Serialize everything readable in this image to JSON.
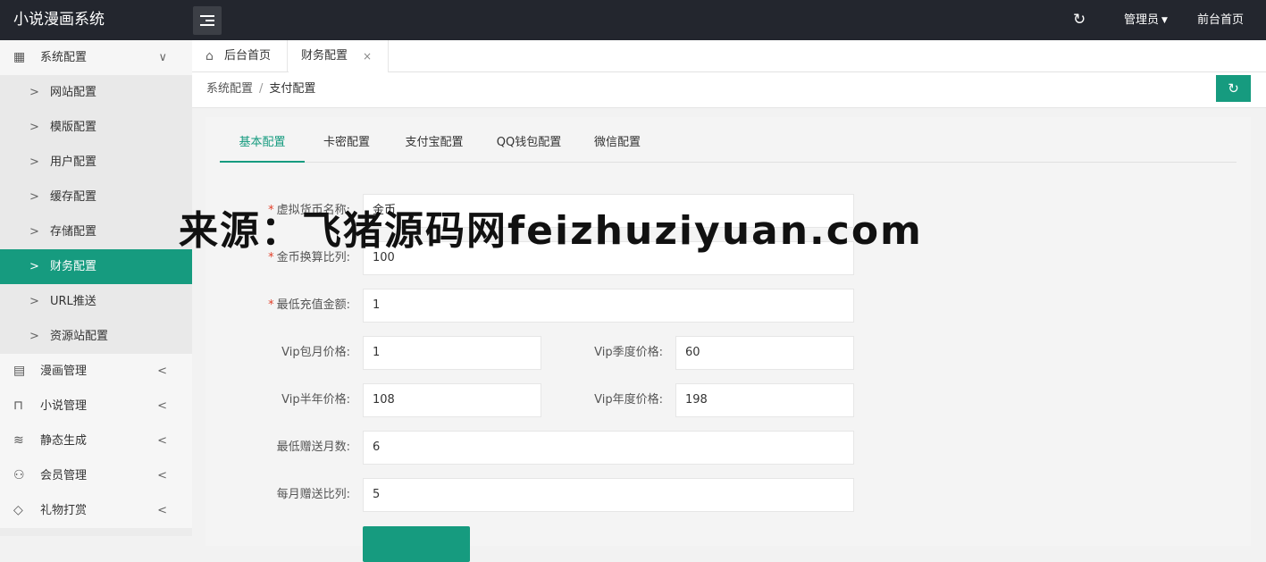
{
  "app": {
    "title": "小说漫画系统",
    "user_menu": "管理员",
    "front_link": "前台首页"
  },
  "icons": {
    "menu_toggle": "hamburger-icon",
    "refresh": "refresh-icon",
    "caret": "caret-down-icon",
    "home": "home-icon",
    "close": "close-icon"
  },
  "sidebar": {
    "groups": [
      {
        "label": "系统配置",
        "icon": "grid-icon",
        "glyph": "▦",
        "expanded": true,
        "chevron": "∨"
      },
      {
        "label": "漫画管理",
        "icon": "book-icon",
        "glyph": "▤",
        "expanded": false,
        "chevron": "<"
      },
      {
        "label": "小说管理",
        "icon": "open-book-icon",
        "glyph": "⊓",
        "expanded": false,
        "chevron": "<"
      },
      {
        "label": "静态生成",
        "icon": "layers-icon",
        "glyph": "≋",
        "expanded": false,
        "chevron": "<"
      },
      {
        "label": "会员管理",
        "icon": "user-icon",
        "glyph": "⚇",
        "expanded": false,
        "chevron": "<"
      },
      {
        "label": "礼物打赏",
        "icon": "diamond-icon",
        "glyph": "◇",
        "expanded": false,
        "chevron": "<"
      }
    ],
    "sub_items": [
      {
        "label": "网站配置"
      },
      {
        "label": "模版配置"
      },
      {
        "label": "用户配置"
      },
      {
        "label": "缓存配置"
      },
      {
        "label": "存储配置"
      },
      {
        "label": "财务配置",
        "active": true
      },
      {
        "label": "URL推送"
      },
      {
        "label": "资源站配置"
      }
    ],
    "sub_arrow": ">"
  },
  "tabs": [
    {
      "label": "后台首页"
    },
    {
      "label": "财务配置",
      "close": "×"
    }
  ],
  "breadcrumb": {
    "parent": "系统配置",
    "separator": "/",
    "current": "支付配置"
  },
  "subtabs": [
    {
      "label": "基本配置",
      "active": true
    },
    {
      "label": "卡密配置"
    },
    {
      "label": "支付宝配置"
    },
    {
      "label": "QQ钱包配置"
    },
    {
      "label": "微信配置"
    }
  ],
  "form": {
    "required_mark": "*",
    "currency_name_label": "虚拟货币名称:",
    "currency_name_value": "金币",
    "ratio_label": "金币换算比列:",
    "ratio_value": "100",
    "min_recharge_label": "最低充值金额:",
    "min_recharge_value": "1",
    "vip_month_label": "Vip包月价格:",
    "vip_month_value": "1",
    "vip_quarter_label": "Vip季度价格:",
    "vip_quarter_value": "60",
    "vip_half_label": "Vip半年价格:",
    "vip_half_value": "108",
    "vip_year_label": "Vip年度价格:",
    "vip_year_value": "198",
    "min_gift_months_label": "最低赠送月数:",
    "min_gift_months_value": "6",
    "monthly_gift_ratio_label": "每月赠送比列:",
    "monthly_gift_ratio_value": "5"
  },
  "watermark": "来源：飞猪源码网feizhuziyuan.com",
  "colors": {
    "accent": "#169b7f",
    "topbar": "#23262e",
    "required": "#e2402a"
  }
}
